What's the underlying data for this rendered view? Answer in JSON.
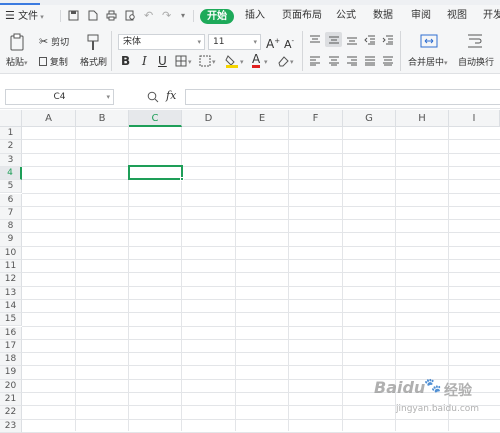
{
  "menu": {
    "file_label": "文件",
    "tabs": [
      "开始",
      "插入",
      "页面布局",
      "公式",
      "数据",
      "审阅",
      "视图",
      "开发"
    ]
  },
  "ribbon": {
    "paste_label": "粘贴",
    "cut_label": "剪切",
    "copy_label": "复制",
    "format_painter_label": "格式刷",
    "font_name": "宋体",
    "font_size": "11",
    "merge_center_label": "合并居中",
    "wrap_text_label": "自动换行"
  },
  "formula_bar": {
    "name_box": "C4",
    "fx_label": "fx",
    "formula_value": ""
  },
  "sheet": {
    "columns": [
      "A",
      "B",
      "C",
      "D",
      "E",
      "F",
      "G",
      "H",
      "I"
    ],
    "rows": [
      "1",
      "2",
      "3",
      "4",
      "5",
      "6",
      "7",
      "8",
      "9",
      "10",
      "11",
      "12",
      "13",
      "14",
      "15",
      "16",
      "17",
      "18",
      "19",
      "20",
      "21",
      "22",
      "23"
    ],
    "selected_column": "C",
    "selected_row": "4",
    "selected_cell": "C4"
  },
  "watermark": {
    "brand": "Baidu",
    "sub": "经验",
    "url": "jingyan.baidu.com"
  },
  "colors": {
    "accent": "#1eaa5a",
    "selection": "#1e9e58"
  }
}
